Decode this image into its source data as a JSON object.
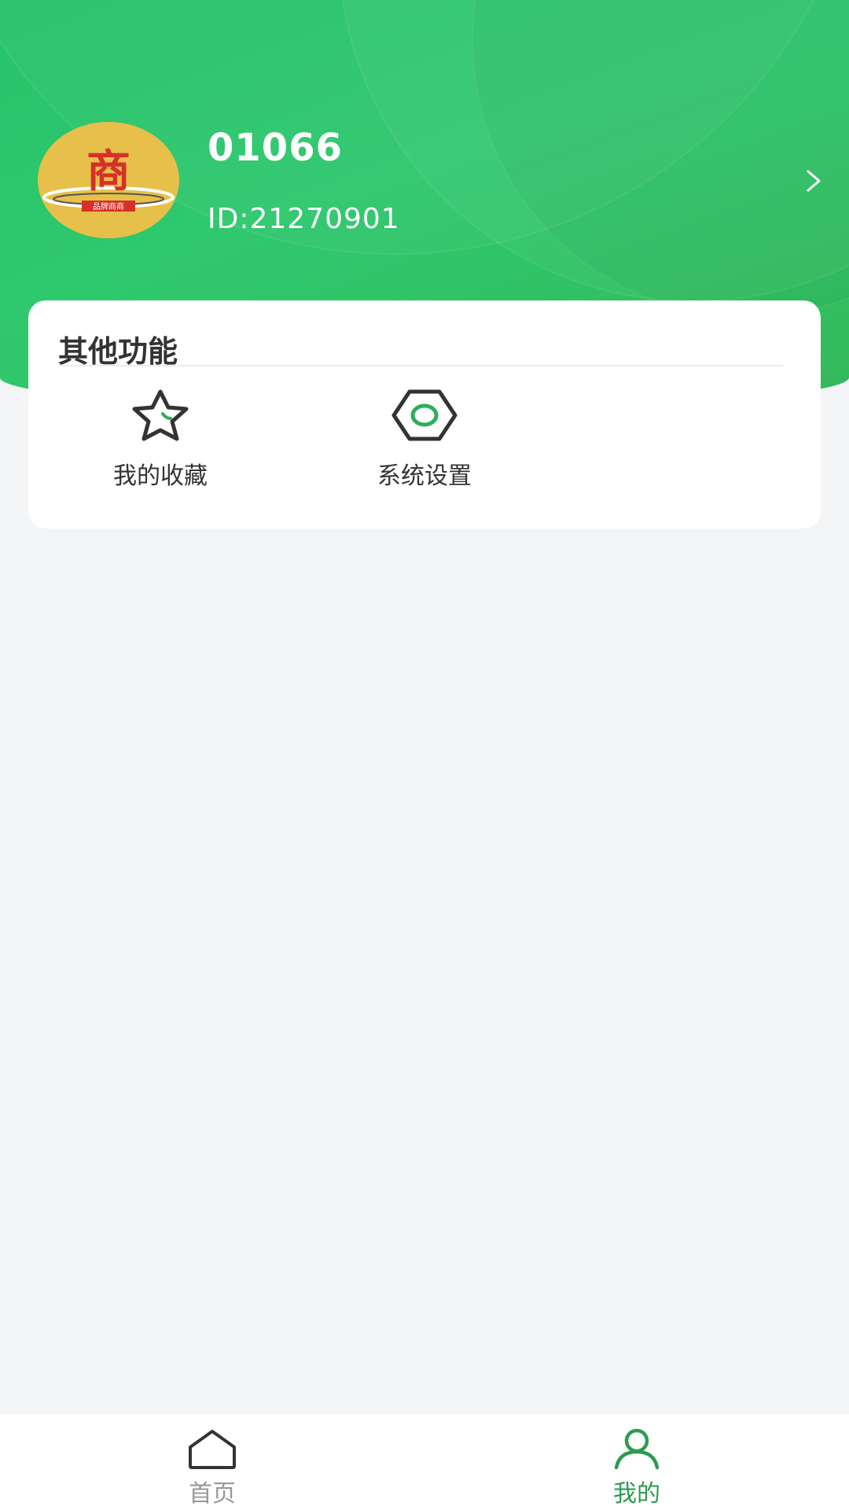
{
  "profile": {
    "username": "01066",
    "user_id": "ID:21270901",
    "avatar_text": "商",
    "avatar_subtext": "品牌商商"
  },
  "other_functions": {
    "title": "其他功能",
    "items": [
      {
        "label": "我的收藏",
        "icon": "star-icon"
      },
      {
        "label": "系统设置",
        "icon": "hexagon-settings-icon"
      }
    ]
  },
  "tabbar": {
    "tabs": [
      {
        "label": "首页",
        "icon": "home-icon",
        "active": false
      },
      {
        "label": "我的",
        "icon": "user-icon",
        "active": true
      }
    ]
  },
  "colors": {
    "brand_green": "#2fc86e",
    "active_tab": "#2e9b50",
    "inactive_tab": "#999999",
    "icon_stroke": "#333333"
  }
}
